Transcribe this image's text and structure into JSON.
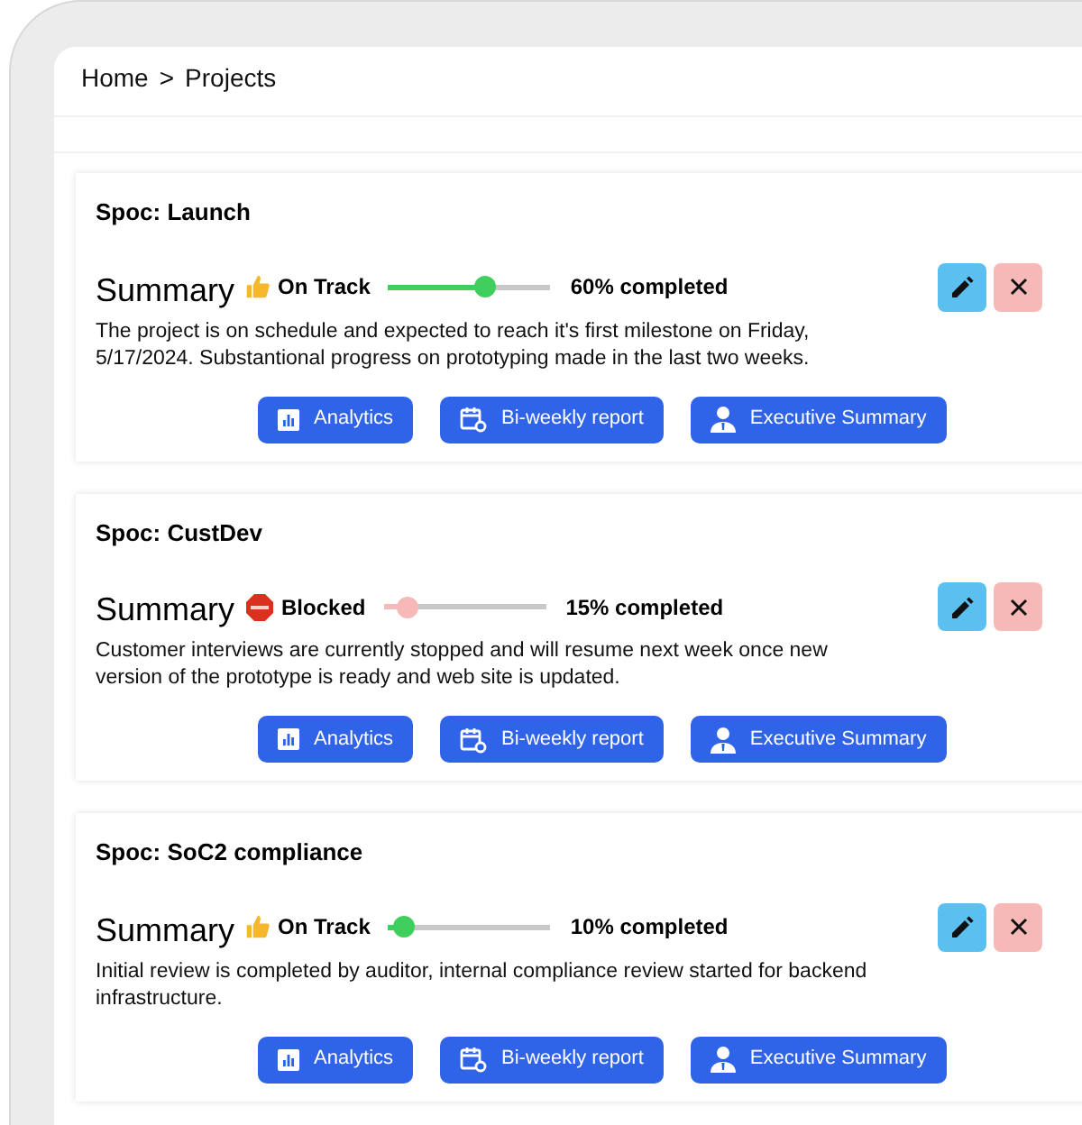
{
  "breadcrumb": [
    {
      "label": "Home"
    },
    {
      "label": ">"
    },
    {
      "label": "Projects"
    }
  ],
  "projects": [
    {
      "title": "Spoc: Launch",
      "heading": "Summary",
      "status": {
        "kind": "on_track",
        "label": "On Track"
      },
      "progress": {
        "level": 0.6,
        "reading": "60% completed"
      },
      "description": "The project is on schedule and expected to reach it's first milestone on Friday, 5/17/2024. Substantional progress on prototyping made in the last two weeks.",
      "buttons": [
        {
          "kind": "analytics",
          "label": "Analytics"
        },
        {
          "kind": "report",
          "label": "Bi-weekly report"
        },
        {
          "kind": "executive",
          "label": "Executive Summary"
        }
      ]
    },
    {
      "title": "Spoc: CustDev",
      "heading": "Summary",
      "status": {
        "kind": "blocked",
        "label": "Blocked"
      },
      "progress": {
        "level": 0.15,
        "reading": "15% completed"
      },
      "description": "Customer interviews are currently stopped and will resume next week once new version of the prototype is ready and web site is updated.",
      "buttons": [
        {
          "kind": "analytics",
          "label": "Analytics"
        },
        {
          "kind": "report",
          "label": "Bi-weekly report"
        },
        {
          "kind": "executive",
          "label": "Executive Summary"
        }
      ]
    },
    {
      "title": "Spoc: SoC2 compliance",
      "heading": "Summary",
      "status": {
        "kind": "on_track",
        "label": "On Track"
      },
      "progress": {
        "level": 0.1,
        "reading": "10% completed"
      },
      "description": "Initial review is completed by auditor, internal compliance review started for backend infrastructure.",
      "buttons": [
        {
          "kind": "analytics",
          "label": "Analytics"
        },
        {
          "kind": "report",
          "label": "Bi-weekly report"
        },
        {
          "kind": "executive",
          "label": "Executive Summary"
        }
      ]
    }
  ]
}
